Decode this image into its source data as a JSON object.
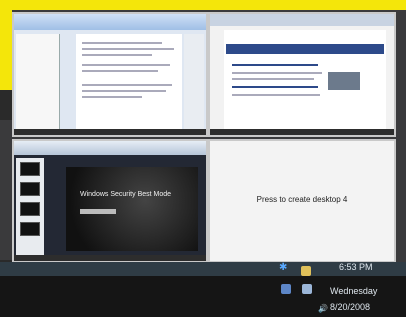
{
  "desktops": [
    {
      "name": "desktop-1",
      "content": ""
    },
    {
      "name": "desktop-2",
      "content": ""
    },
    {
      "name": "desktop-3",
      "slide_title": "Windows Security Best Mode"
    },
    {
      "name": "desktop-4",
      "label": "Press to create desktop 4"
    }
  ],
  "taskbar": {
    "time": "6:53 PM",
    "day": "Wednesday",
    "date": "8/20/2008"
  },
  "icons": [
    "bluetooth-icon",
    "network-icon",
    "power-icon",
    "volume-icon"
  ]
}
